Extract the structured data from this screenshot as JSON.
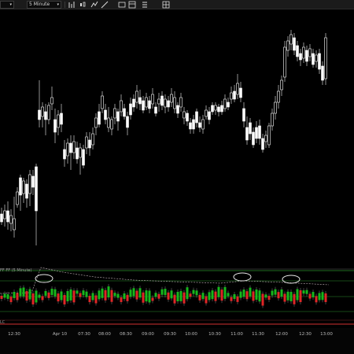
{
  "toolbar": {
    "symbol_value": "",
    "interval_value": "5 Minute",
    "icons": [
      "bar-chart-icon",
      "candlestick-icon",
      "indicators-icon",
      "drawing-tools-icon",
      "image-icon",
      "templates-icon",
      "properties-icon",
      "grid-icon"
    ]
  },
  "indicator": {
    "label": "FF FF (5 Minute)",
    "bottom_label": "LC",
    "colors": {
      "up": "#16b81c",
      "down": "#e02626",
      "band": "#2d8f2d",
      "zero": "#d32f2f",
      "ma": "#c6b7bd"
    }
  },
  "price_panel": {
    "candle_color": "#ffffff"
  },
  "xaxis": {
    "labels": [
      "12:30",
      "Apr 10",
      "07:30",
      "08:00",
      "08:30",
      "09:00",
      "09:30",
      "10:00",
      "10:30",
      "11:00",
      "11:30",
      "12:00",
      "12:30",
      "13:00"
    ]
  },
  "chart_data": {
    "type": "candlestick",
    "note_values": "price series values unlabeled in screenshot; represented visually only",
    "x": [
      "12:30",
      "Apr 10",
      "07:30",
      "08:00",
      "08:30",
      "09:00",
      "09:30",
      "10:00",
      "10:30",
      "11:00",
      "11:30",
      "12:00",
      "12:30",
      "13:00"
    ]
  }
}
